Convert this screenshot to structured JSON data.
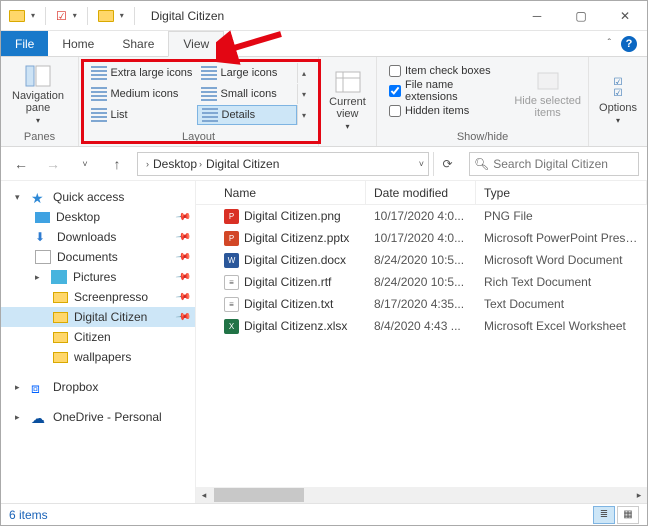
{
  "titlebar": {
    "title": "Digital Citizen"
  },
  "tabs": {
    "file": "File",
    "home": "Home",
    "share": "Share",
    "view": "View"
  },
  "ribbon": {
    "panes": {
      "nav": "Navigation\npane",
      "label": "Panes"
    },
    "layout": {
      "extra_large": "Extra large icons",
      "large": "Large icons",
      "medium": "Medium icons",
      "small": "Small icons",
      "list": "List",
      "details": "Details",
      "label": "Layout"
    },
    "current_view": {
      "btn": "Current\nview",
      "label": ""
    },
    "showhide": {
      "item_check": "Item check boxes",
      "file_ext": "File name extensions",
      "hidden": "Hidden items",
      "hide_selected": "Hide selected\nitems",
      "label": "Show/hide"
    },
    "options": "Options"
  },
  "breadcrumb": {
    "desktop": "Desktop",
    "dc": "Digital Citizen"
  },
  "search": {
    "placeholder": "Search Digital Citizen"
  },
  "sidebar": {
    "quick_access": "Quick access",
    "desktop": "Desktop",
    "downloads": "Downloads",
    "documents": "Documents",
    "pictures": "Pictures",
    "screenpresso": "Screenpresso",
    "digital_citizen": "Digital Citizen",
    "citizen": "Citizen",
    "wallpapers": "wallpapers",
    "dropbox": "Dropbox",
    "onedrive": "OneDrive - Personal"
  },
  "columns": {
    "name": "Name",
    "date": "Date modified",
    "type": "Type"
  },
  "files": [
    {
      "icon": "png",
      "name": "Digital Citizen.png",
      "date": "10/17/2020 4:0...",
      "type": "PNG File"
    },
    {
      "icon": "pptx",
      "name": "Digital Citizenz.pptx",
      "date": "10/17/2020 4:0...",
      "type": "Microsoft PowerPoint Presenta..."
    },
    {
      "icon": "docx",
      "name": "Digital Citizen.docx",
      "date": "8/24/2020 10:5...",
      "type": "Microsoft Word Document"
    },
    {
      "icon": "rtf",
      "name": "Digital Citizen.rtf",
      "date": "8/24/2020 10:5...",
      "type": "Rich Text Document"
    },
    {
      "icon": "txt",
      "name": "Digital Citizen.txt",
      "date": "8/17/2020 4:35...",
      "type": "Text Document"
    },
    {
      "icon": "xlsx",
      "name": "Digital Citizenz.xlsx",
      "date": "8/4/2020 4:43 ...",
      "type": "Microsoft Excel Worksheet"
    }
  ],
  "status": {
    "count": "6 items"
  }
}
